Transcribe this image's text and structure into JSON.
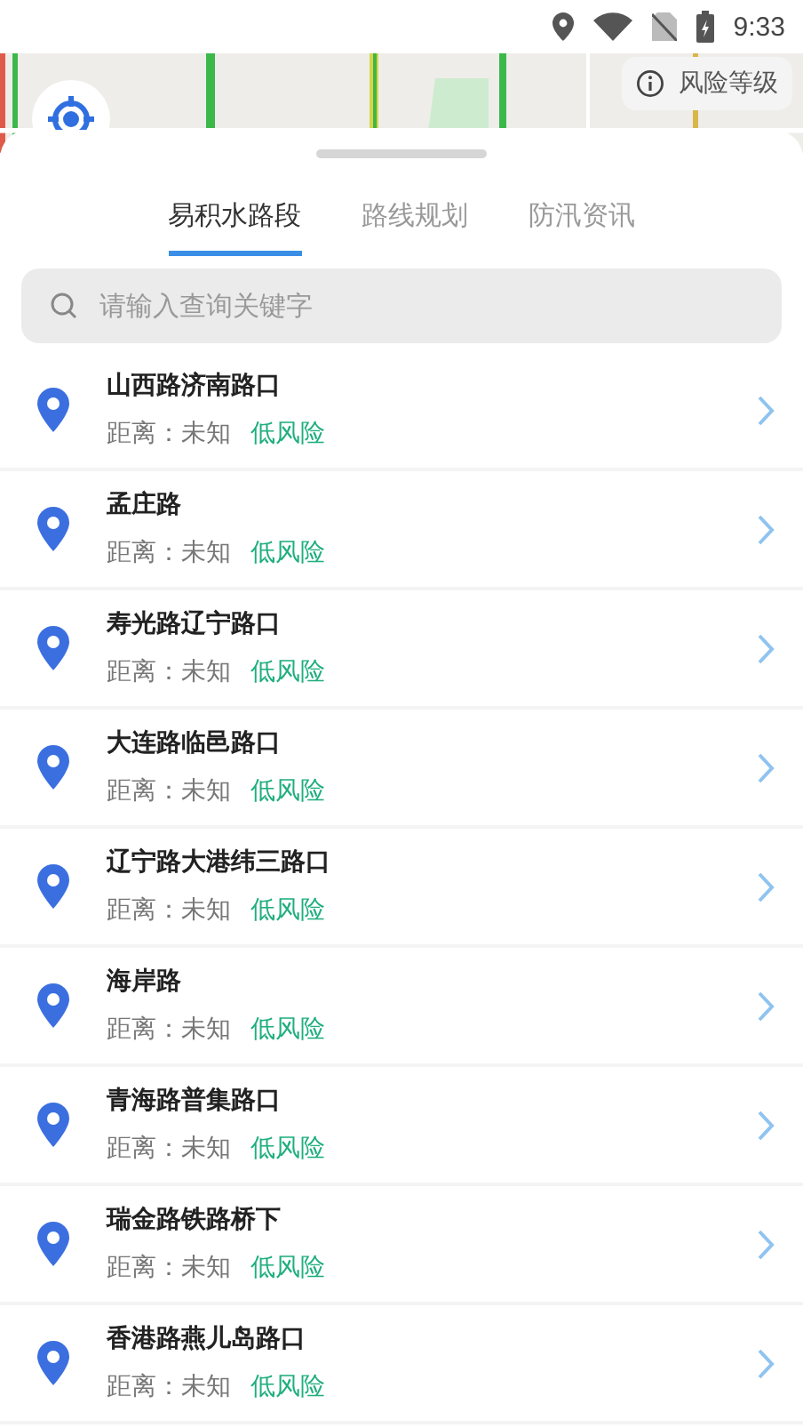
{
  "status_bar": {
    "time": "9:33"
  },
  "map": {
    "risk_button": "风险等级"
  },
  "tabs": [
    {
      "label": "易积水路段",
      "selected": true
    },
    {
      "label": "路线规划",
      "selected": false
    },
    {
      "label": "防汛资讯",
      "selected": false
    }
  ],
  "search": {
    "placeholder": "请输入查询关键字"
  },
  "roads": [
    {
      "name": "山西路济南路口",
      "distance": "距离：未知",
      "risk": "低风险"
    },
    {
      "name": "孟庄路",
      "distance": "距离：未知",
      "risk": "低风险"
    },
    {
      "name": "寿光路辽宁路口",
      "distance": "距离：未知",
      "risk": "低风险"
    },
    {
      "name": "大连路临邑路口",
      "distance": "距离：未知",
      "risk": "低风险"
    },
    {
      "name": "辽宁路大港纬三路口",
      "distance": "距离：未知",
      "risk": "低风险"
    },
    {
      "name": "海岸路",
      "distance": "距离：未知",
      "risk": "低风险"
    },
    {
      "name": "青海路普集路口",
      "distance": "距离：未知",
      "risk": "低风险"
    },
    {
      "name": "瑞金路铁路桥下",
      "distance": "距离：未知",
      "risk": "低风险"
    },
    {
      "name": "香港路燕儿岛路口",
      "distance": "距离：未知",
      "risk": "低风险"
    }
  ]
}
